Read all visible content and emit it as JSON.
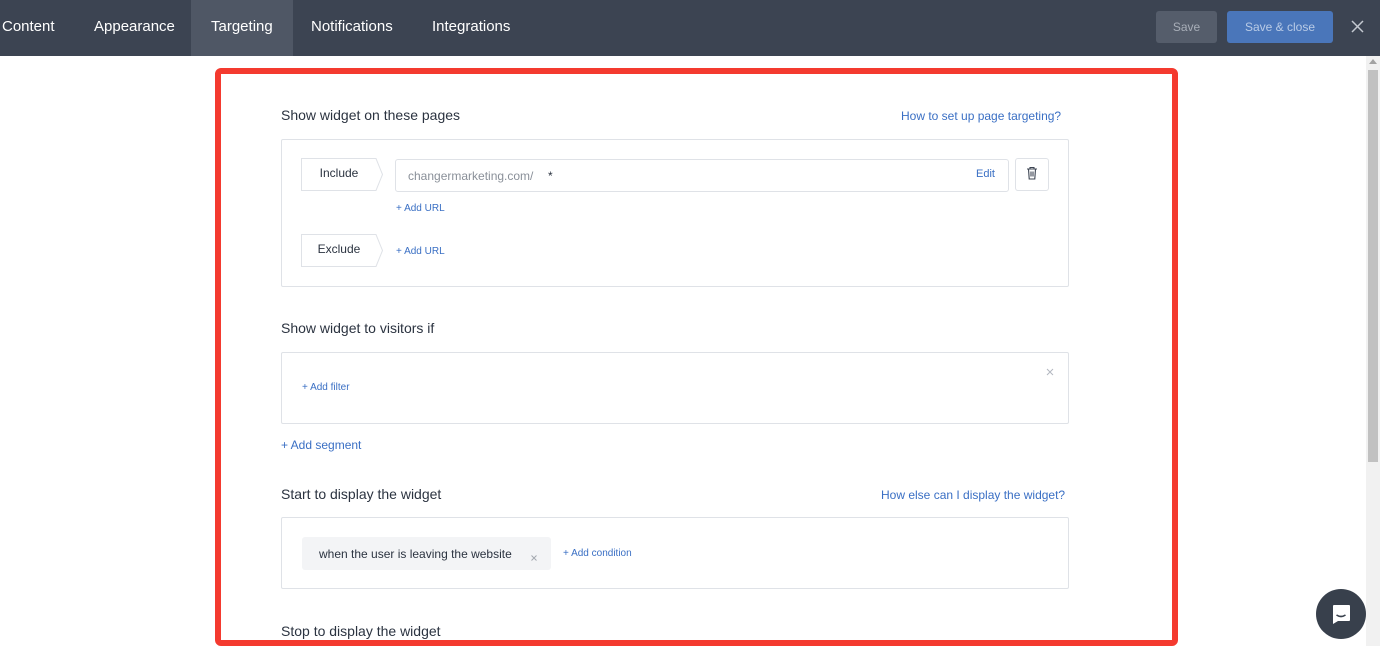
{
  "tabs": [
    {
      "label": "Content"
    },
    {
      "label": "Appearance"
    },
    {
      "label": "Targeting",
      "active": true
    },
    {
      "label": "Notifications"
    },
    {
      "label": "Integrations"
    }
  ],
  "toolbar": {
    "save_label": "Save",
    "save_close_label": "Save & close",
    "close_icon": "close-icon"
  },
  "page_targeting": {
    "title": "Show widget on these pages",
    "help_link": "How to set up page targeting?",
    "include_label": "Include",
    "include_url": "changermarketing.com/",
    "include_url_wildcard": "*",
    "edit_label": "Edit",
    "delete_icon": "trash-icon",
    "add_url_include": "+ Add URL",
    "exclude_label": "Exclude",
    "add_url_exclude": "+ Add URL"
  },
  "visitors": {
    "title": "Show widget to visitors if",
    "add_filter": "+ Add filter",
    "remove_icon": "close-icon",
    "add_segment": "+ Add segment"
  },
  "start_display": {
    "title": "Start to display the widget",
    "help_link": "How else can I display the widget?",
    "condition_chip": "when the user is leaving the website",
    "add_condition": "+ Add condition"
  },
  "stop_display": {
    "title": "Stop to display the widget"
  },
  "chat": {
    "icon": "chat-icon"
  },
  "colors": {
    "topbar": "#3c4452",
    "active_tab": "#4f5765",
    "accent_button": "#4a76ba",
    "link": "#3a6fc4",
    "highlight_frame": "#f43a2f"
  }
}
